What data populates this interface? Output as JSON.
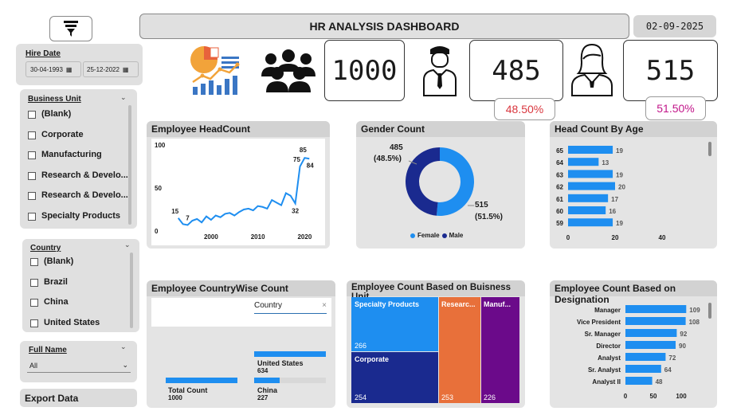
{
  "header": {
    "title": "HR ANALYSIS DASHBOARD",
    "date": "02-09-2025"
  },
  "filter_icon": "funnel-icon",
  "kpis": {
    "total": "1000",
    "male_count": "485",
    "male_pct": "48.50%",
    "female_count": "515",
    "female_pct": "51.50%",
    "male_pct_color": "#d9363e",
    "female_pct_color": "#c2168a"
  },
  "hire_date": {
    "title": "Hire Date",
    "start": "30-04-1993",
    "end": "25-12-2022"
  },
  "business_unit_slicer": {
    "title": "Business Unit",
    "items": [
      "(Blank)",
      "Corporate",
      "Manufacturing",
      "Research & Develo...",
      "Research & Develo...",
      "Specialty Products"
    ]
  },
  "country_slicer": {
    "title": "Country",
    "items": [
      "(Blank)",
      "Brazil",
      "China",
      "United States"
    ]
  },
  "full_name_slicer": {
    "title": "Full Name",
    "value": "All"
  },
  "export": {
    "label": "Export Data"
  },
  "headcount_chart": {
    "title": "Employee HeadCount",
    "y_ticks": [
      "100",
      "50",
      "0"
    ],
    "x_ticks": [
      "2000",
      "2010",
      "2020"
    ],
    "labels": [
      "15",
      "7",
      "32",
      "75",
      "85",
      "84"
    ]
  },
  "gender_chart": {
    "title": "Gender Count",
    "male_label": "485",
    "male_pct_label": "(48.5%)",
    "female_label": "515",
    "female_pct_label": "(51.5%)",
    "legend_female": "Female",
    "legend_male": "Male",
    "female_color": "#1e8ef0",
    "male_color": "#1a2a8f"
  },
  "age_chart": {
    "title": "Head Count By Age",
    "ages": [
      "65",
      "64",
      "63",
      "62",
      "61",
      "60",
      "59"
    ],
    "values": [
      "19",
      "13",
      "19",
      "20",
      "17",
      "16",
      "19"
    ],
    "x_ticks": [
      "0",
      "20",
      "40"
    ]
  },
  "country_card": {
    "title": "Employee CountryWise Count",
    "search_placeholder": "Country",
    "total_label": "Total Count",
    "total_value": "1000",
    "us_label": "United States",
    "us_value": "634",
    "china_label": "China",
    "china_value": "227"
  },
  "bu_chart": {
    "title": "Employee Count Based on Buisness Unit",
    "specialty_label": "Specialty Products",
    "specialty_value": "266",
    "corporate_label": "Corporate",
    "corporate_value": "254",
    "research_label": "Researc...",
    "research_value": "253",
    "manuf_label": "Manuf...",
    "manuf_value": "226",
    "colors": {
      "specialty": "#1e8ef0",
      "corporate": "#1a2a8f",
      "research": "#e8703a",
      "manuf": "#6b0a8a"
    }
  },
  "designation_chart": {
    "title": "Employee Count Based on Designation",
    "roles": [
      "Manager",
      "Vice President",
      "Sr. Manager",
      "Director",
      "Analyst",
      "Sr. Analyst",
      "Analyst II"
    ],
    "values": [
      "109",
      "108",
      "92",
      "90",
      "72",
      "64",
      "48"
    ],
    "x_ticks": [
      "0",
      "50",
      "100"
    ]
  },
  "chart_data": [
    {
      "type": "line",
      "title": "Employee HeadCount",
      "ylim": [
        0,
        100
      ],
      "x_ticks": [
        2000,
        2010,
        2020
      ],
      "labeled_points": [
        {
          "x": 1993,
          "y": 15
        },
        {
          "x": 1995,
          "y": 7
        },
        {
          "x": 2018,
          "y": 32
        },
        {
          "x": 2019,
          "y": 75
        },
        {
          "x": 2020,
          "y": 85
        },
        {
          "x": 2021,
          "y": 84
        }
      ],
      "x": [
        1993,
        1994,
        1995,
        1996,
        1997,
        1998,
        1999,
        2000,
        2001,
        2002,
        2003,
        2004,
        2005,
        2006,
        2007,
        2008,
        2009,
        2010,
        2011,
        2012,
        2013,
        2014,
        2015,
        2016,
        2017,
        2018,
        2019,
        2020,
        2021
      ],
      "y": [
        15,
        8,
        7,
        12,
        14,
        10,
        17,
        13,
        18,
        16,
        20,
        21,
        18,
        22,
        25,
        26,
        24,
        29,
        28,
        26,
        36,
        33,
        30,
        44,
        41,
        32,
        75,
        85,
        84
      ]
    },
    {
      "type": "pie",
      "title": "Gender Count",
      "categories": [
        "Female",
        "Male"
      ],
      "values": [
        515,
        485
      ]
    },
    {
      "type": "bar",
      "title": "Head Count By Age",
      "categories": [
        "65",
        "64",
        "63",
        "62",
        "61",
        "60",
        "59"
      ],
      "values": [
        19,
        13,
        19,
        20,
        17,
        16,
        19
      ],
      "xlim": [
        0,
        40
      ]
    },
    {
      "type": "bar",
      "title": "Employee CountryWise Count",
      "categories": [
        "Total Count",
        "United States",
        "China"
      ],
      "values": [
        1000,
        634,
        227
      ]
    },
    {
      "type": "heatmap",
      "title": "Employee Count Based on Buisness Unit",
      "categories": [
        "Specialty Products",
        "Corporate",
        "Researc...",
        "Manuf..."
      ],
      "values": [
        266,
        254,
        253,
        226
      ]
    },
    {
      "type": "bar",
      "title": "Employee Count Based on Designation",
      "categories": [
        "Manager",
        "Vice President",
        "Sr. Manager",
        "Director",
        "Analyst",
        "Sr. Analyst",
        "Analyst II"
      ],
      "values": [
        109,
        108,
        92,
        90,
        72,
        64,
        48
      ],
      "xlim": [
        0,
        100
      ]
    }
  ]
}
